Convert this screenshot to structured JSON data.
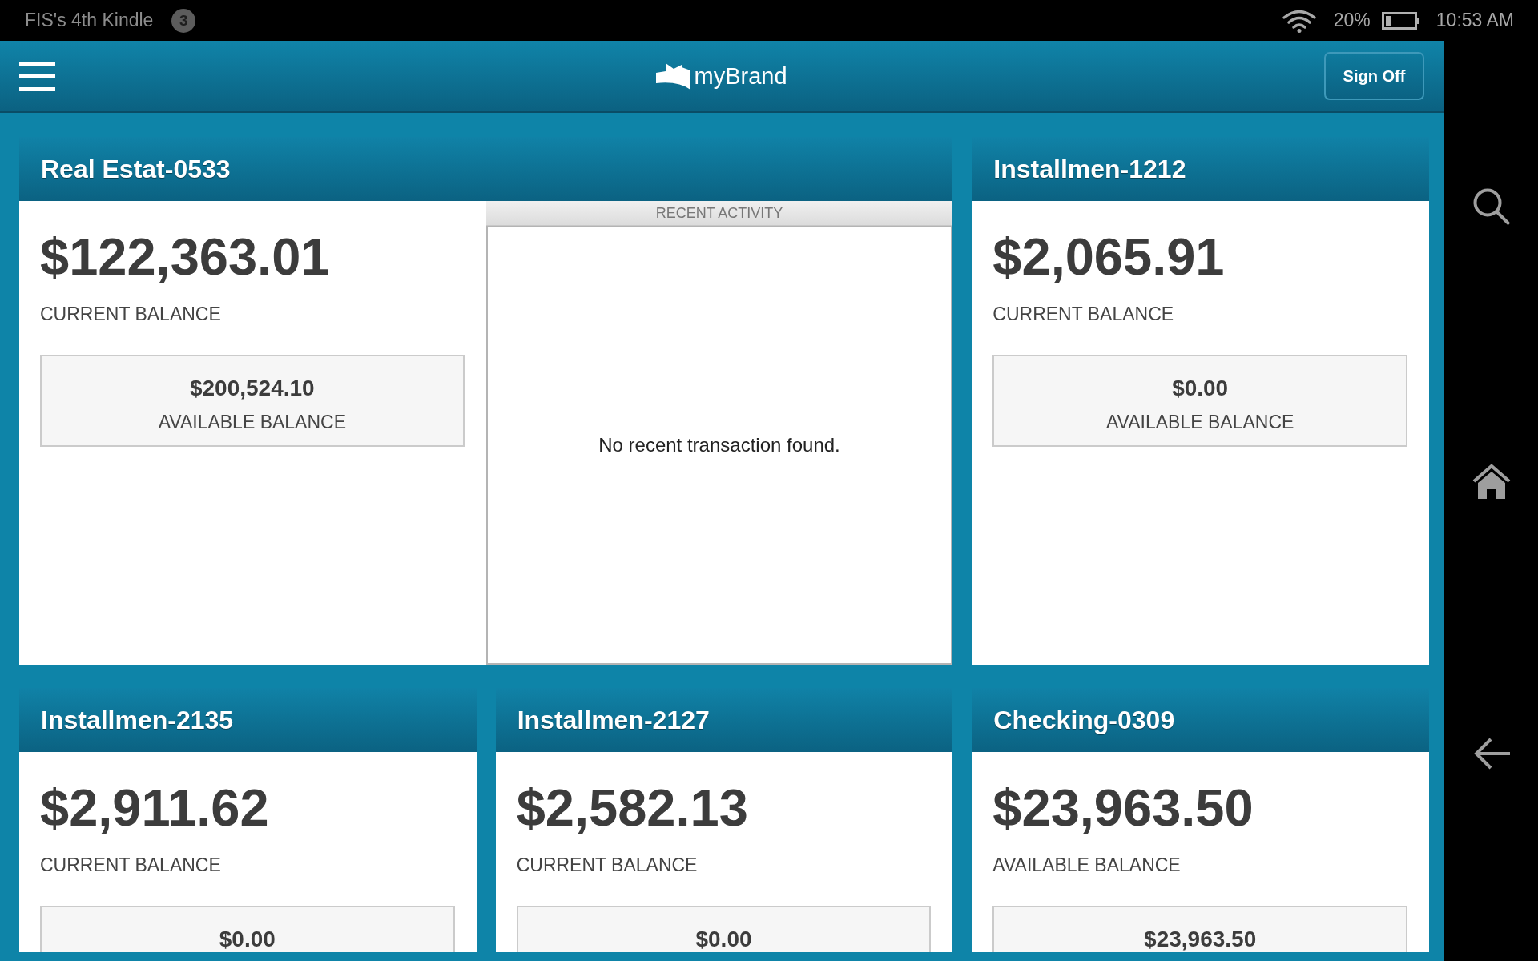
{
  "status_bar": {
    "device_name": "FIS's 4th Kindle",
    "notification_count": "3",
    "battery": "20%",
    "time": "10:53 AM"
  },
  "header": {
    "brand": "myBrand",
    "sign_off": "Sign Off"
  },
  "accounts": [
    {
      "title": "Real Estat-0533",
      "balance": "$122,363.01",
      "balance_label": "CURRENT BALANCE",
      "available": {
        "value": "$200,524.10",
        "label": "AVAILABLE BALANCE"
      },
      "recent_activity": {
        "title": "RECENT ACTIVITY",
        "message": "No recent transaction found."
      }
    },
    {
      "title": "Installmen-1212",
      "balance": "$2,065.91",
      "balance_label": "CURRENT BALANCE",
      "available": {
        "value": "$0.00",
        "label": "AVAILABLE BALANCE"
      }
    },
    {
      "title": "Installmen-2135",
      "balance": "$2,911.62",
      "balance_label": "CURRENT BALANCE",
      "available": {
        "value": "$0.00"
      }
    },
    {
      "title": "Installmen-2127",
      "balance": "$2,582.13",
      "balance_label": "CURRENT BALANCE",
      "available": {
        "value": "$0.00"
      }
    },
    {
      "title": "Checking-0309",
      "balance": "$23,963.50",
      "balance_label": "AVAILABLE BALANCE",
      "available": {
        "value": "$23,963.50"
      }
    }
  ]
}
